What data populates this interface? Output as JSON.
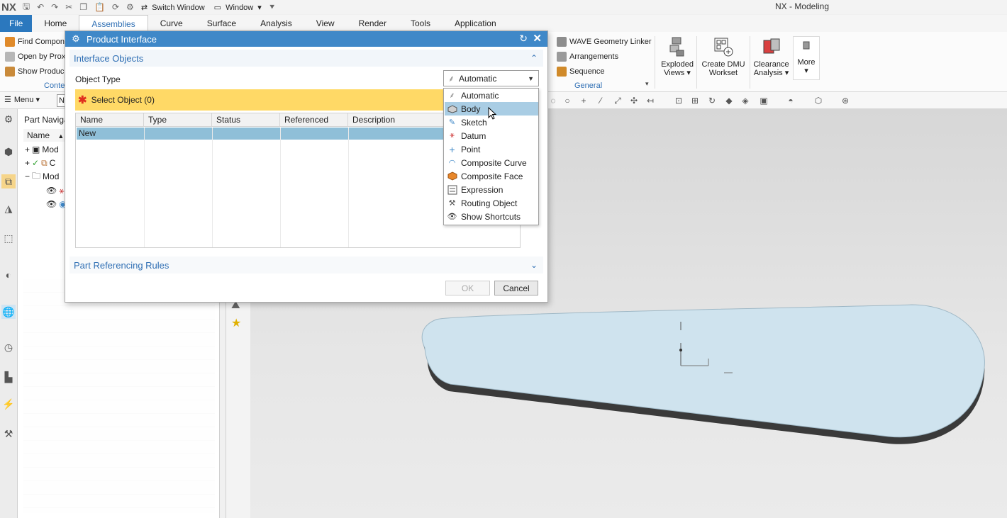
{
  "app": {
    "logo": "NX",
    "title": "NX - Modeling",
    "quick_access": {
      "switch_window": "Switch Window",
      "window_menu": "Window"
    }
  },
  "tabs": [
    {
      "label": "File"
    },
    {
      "label": "Home"
    },
    {
      "label": "Assemblies"
    },
    {
      "label": "Curve"
    },
    {
      "label": "Surface"
    },
    {
      "label": "Analysis"
    },
    {
      "label": "View"
    },
    {
      "label": "Render"
    },
    {
      "label": "Tools"
    },
    {
      "label": "Application"
    }
  ],
  "ribbon": {
    "context_group": {
      "items": [
        "Find Compon",
        "Open by Prox",
        "Show Produc"
      ],
      "label": "Conte"
    },
    "general_group": {
      "items": [
        "WAVE Geometry Linker",
        "Arrangements",
        "Sequence"
      ],
      "label": "General"
    },
    "big_buttons": [
      {
        "label_line1": "Exploded",
        "label_line2": "Views ▾"
      },
      {
        "label_line1": "Create DMU",
        "label_line2": "Workset"
      },
      {
        "label_line1": "Clearance",
        "label_line2": "Analysis ▾"
      },
      {
        "label_line1": "More",
        "label_line2": "▾"
      }
    ]
  },
  "command_bar": {
    "menu_label": "Menu ▾",
    "filter_first_char": "N"
  },
  "part_navigator": {
    "title": "Part Navigat",
    "column_header": "Name",
    "rows": [
      "Mod",
      "C",
      "Mod"
    ]
  },
  "dialog": {
    "title": "Product Interface",
    "section_interface_objects": "Interface Objects",
    "object_type_label": "Object Type",
    "object_type_value": "Automatic",
    "select_object": "Select Object (0)",
    "columns": [
      "Name",
      "Type",
      "Status",
      "Referenced",
      "Description"
    ],
    "rows": [
      {
        "name": "New"
      }
    ],
    "section_part_referencing": "Part Referencing Rules",
    "ok_label": "OK",
    "cancel_label": "Cancel"
  },
  "dropdown": {
    "options": [
      {
        "label": "Automatic",
        "icon": "wand-icon"
      },
      {
        "label": "Body",
        "icon": "body-icon"
      },
      {
        "label": "Sketch",
        "icon": "sketch-icon"
      },
      {
        "label": "Datum",
        "icon": "datum-icon"
      },
      {
        "label": "Point",
        "icon": "point-icon"
      },
      {
        "label": "Composite Curve",
        "icon": "composite-curve-icon"
      },
      {
        "label": "Composite Face",
        "icon": "composite-face-icon"
      },
      {
        "label": "Expression",
        "icon": "expression-icon"
      },
      {
        "label": "Routing Object",
        "icon": "routing-icon"
      },
      {
        "label": "Show Shortcuts",
        "icon": "eye-icon"
      }
    ],
    "highlighted_index": 1
  },
  "colors": {
    "dialog_title": "#3f88c8",
    "selection_required": "#ffd966",
    "row_selected": "#8fbfd8",
    "dropdown_highlight": "#a9cde4",
    "part_face": "#cfe3ee"
  }
}
